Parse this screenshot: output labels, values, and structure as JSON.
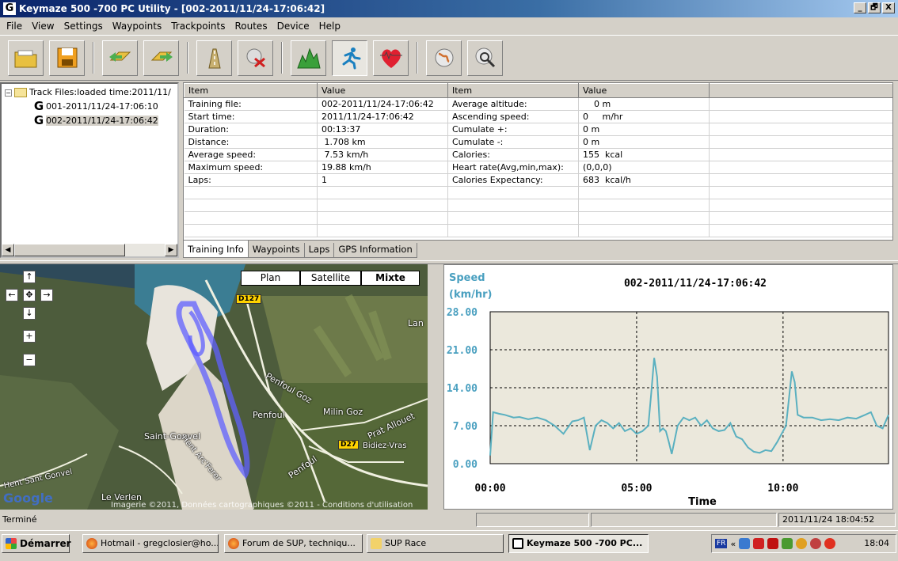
{
  "window": {
    "title": "Keymaze 500 -700 PC Utility - [002-2011/11/24-17:06:42]",
    "minimize": "_",
    "restore": "🗗",
    "close": "X"
  },
  "menu": [
    "File",
    "View",
    "Settings",
    "Waypoints",
    "Trackpoints",
    "Routes",
    "Device",
    "Help"
  ],
  "toolbar": {
    "icons": [
      "open-folder-icon",
      "save-icon",
      "upload-icon",
      "download-icon",
      "road-icon",
      "erase-icon",
      "altitude-chart-icon",
      "runner-icon",
      "heart-rate-icon",
      "globe-icon",
      "globe-search-icon"
    ]
  },
  "tree": {
    "root": "Track Files:loaded time:2011/11/",
    "items": [
      "001-2011/11/24-17:06:10",
      "002-2011/11/24-17:06:42"
    ],
    "selected": 1
  },
  "grid": {
    "headers": [
      "Item",
      "Value",
      "Item",
      "Value",
      ""
    ],
    "rows": [
      [
        "Training file:",
        "002-2011/11/24-17:06:42",
        "Average altitude:",
        "    0 m"
      ],
      [
        "Start time:",
        "2011/11/24-17:06:42",
        "Ascending speed:",
        "0     m/hr"
      ],
      [
        "Duration:",
        "00:13:37",
        "Cumulate +:",
        "0 m"
      ],
      [
        "Distance:",
        " 1.708 km",
        "Cumulate -:",
        "0 m"
      ],
      [
        "Average speed:",
        " 7.53 km/h",
        "Calories:",
        "155  kcal"
      ],
      [
        "Maximum speed:",
        "19.88 km/h",
        "Heart rate(Avg,min,max):",
        "(0,0,0)"
      ],
      [
        "Laps:",
        "1",
        "Calories Expectancy:",
        "683  kcal/h"
      ],
      [
        "",
        "",
        "",
        ""
      ],
      [
        "",
        "",
        "",
        ""
      ],
      [
        "",
        "",
        "",
        ""
      ],
      [
        "",
        "",
        "",
        ""
      ]
    ]
  },
  "tabs": [
    "Training Info",
    "Waypoints",
    "Laps",
    "GPS Information"
  ],
  "map": {
    "types": [
      "Plan",
      "Satellite",
      "Mixte"
    ],
    "selected_type": "Mixte",
    "road_labels": [
      "D127",
      "D27"
    ],
    "places": [
      "Lan",
      "Penfoul Goz",
      "Penfoul",
      "Milin Goz",
      "Prat Allouet",
      "Saint-Gonvel",
      "Bidiez-Vras",
      "Hent Sant Gonvel",
      "Hent Arc'Ferer",
      "Penfoul",
      "Le Verlen"
    ],
    "logo": "Google",
    "copyright": "Imagerie ©2011, Données cartographiques ©2011 - Conditions d'utilisation"
  },
  "chart_data": {
    "type": "line",
    "title": "002-2011/11/24-17:06:42",
    "ylabel": "Speed\n(km/hr)",
    "ylabel_line1": "Speed",
    "ylabel_line2": "(km/hr)",
    "xlabel": "Time",
    "ylim": [
      0,
      28
    ],
    "yticks": [
      "28.00",
      "21.00",
      "14.00",
      "7.00",
      "0.00"
    ],
    "xticks": [
      "00:00",
      "05:00",
      "10:00"
    ],
    "xlim_minutes": [
      0,
      13.6
    ],
    "series": [
      {
        "color": "#5ab0c0",
        "x": [
          0,
          0.1,
          0.3,
          0.5,
          0.8,
          1.0,
          1.3,
          1.6,
          1.9,
          2.2,
          2.5,
          2.8,
          3.0,
          3.2,
          3.4,
          3.6,
          3.8,
          4.0,
          4.2,
          4.4,
          4.6,
          4.8,
          5.0,
          5.2,
          5.4,
          5.5,
          5.6,
          5.7,
          5.8,
          5.9,
          6.0,
          6.1,
          6.2,
          6.4,
          6.6,
          6.8,
          7.0,
          7.2,
          7.4,
          7.6,
          7.8,
          8.0,
          8.2,
          8.4,
          8.6,
          8.8,
          9.0,
          9.2,
          9.4,
          9.6,
          9.8,
          10.0,
          10.1,
          10.2,
          10.3,
          10.4,
          10.5,
          10.7,
          11.0,
          11.3,
          11.6,
          11.9,
          12.2,
          12.5,
          12.8,
          13.0,
          13.2,
          13.4,
          13.6
        ],
        "y": [
          1.5,
          9.5,
          9.2,
          9.0,
          8.5,
          8.6,
          8.2,
          8.5,
          8.0,
          7.0,
          5.5,
          7.8,
          8.0,
          8.5,
          2.5,
          7.0,
          8.0,
          7.5,
          6.5,
          7.5,
          6.0,
          6.5,
          5.5,
          6.0,
          7.0,
          13.0,
          19.5,
          16.0,
          6.0,
          6.5,
          6.0,
          4.0,
          1.8,
          7.0,
          8.5,
          8.0,
          8.5,
          7.0,
          8.0,
          6.5,
          6.0,
          6.2,
          7.5,
          5.0,
          4.5,
          3.0,
          2.2,
          2.0,
          2.5,
          2.3,
          4.0,
          6.0,
          7.0,
          12.0,
          17.0,
          15.0,
          9.0,
          8.5,
          8.5,
          8.0,
          8.2,
          8.0,
          8.5,
          8.3,
          9.0,
          9.5,
          7.0,
          6.5,
          9.0
        ]
      }
    ]
  },
  "status": {
    "left": "Terminé",
    "datetime": "2011/11/24 18:04:52"
  },
  "taskbar": {
    "start": "Démarrer",
    "tasks": [
      "Hotmail - gregclosier@ho...",
      "Forum de SUP, techniqu...",
      "SUP Race",
      "Keymaze 500 -700 PC..."
    ],
    "active_task": 3,
    "tray_lang": "FR",
    "tray_chevron": "«",
    "clock": "18:04"
  }
}
